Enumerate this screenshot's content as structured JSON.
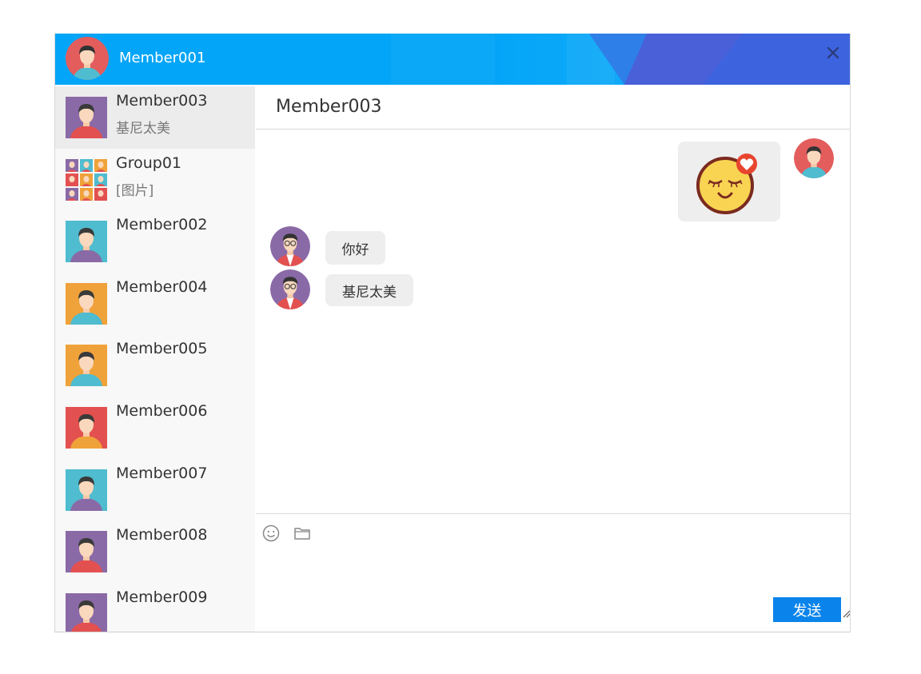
{
  "header": {
    "self_name": "Member001",
    "close_icon": "close-icon"
  },
  "contacts": [
    {
      "name": "Member003",
      "last_message": "基尼太美",
      "active": true,
      "bg": "#8a6aa6",
      "shirt": "#e35050"
    },
    {
      "name": "Group01",
      "last_message": "[图片]",
      "active": false,
      "group": true
    },
    {
      "name": "Member002",
      "last_message": "",
      "active": false,
      "bg": "#4fbccf",
      "shirt": "#8a6aa6"
    },
    {
      "name": "Member004",
      "last_message": "",
      "active": false,
      "bg": "#f0a23a",
      "shirt": "#4fbccf"
    },
    {
      "name": "Member005",
      "last_message": "",
      "active": false,
      "bg": "#f0a23a",
      "shirt": "#4fbccf"
    },
    {
      "name": "Member006",
      "last_message": "",
      "active": false,
      "bg": "#e35050",
      "shirt": "#f0a23a"
    },
    {
      "name": "Member007",
      "last_message": "",
      "active": false,
      "bg": "#4fbccf",
      "shirt": "#8a6aa6"
    },
    {
      "name": "Member008",
      "last_message": "",
      "active": false,
      "bg": "#8a6aa6",
      "shirt": "#e35050"
    },
    {
      "name": "Member009",
      "last_message": "",
      "active": false,
      "bg": "#8a6aa6",
      "shirt": "#e35050"
    }
  ],
  "chat": {
    "title": "Member003",
    "messages": [
      {
        "from": "self",
        "type": "sticker",
        "sticker": "happy-face-heart-sticker"
      },
      {
        "from": "Member003",
        "type": "text",
        "text": "你好"
      },
      {
        "from": "Member003",
        "type": "text",
        "text": "基尼太美"
      }
    ]
  },
  "input": {
    "emoji_icon": "emoji-icon",
    "file_icon": "folder-icon",
    "send_label": "发送"
  },
  "colors": {
    "titlebar": "#03a5f8",
    "send_button": "#0a84ea",
    "bubble": "#eeeeee"
  }
}
